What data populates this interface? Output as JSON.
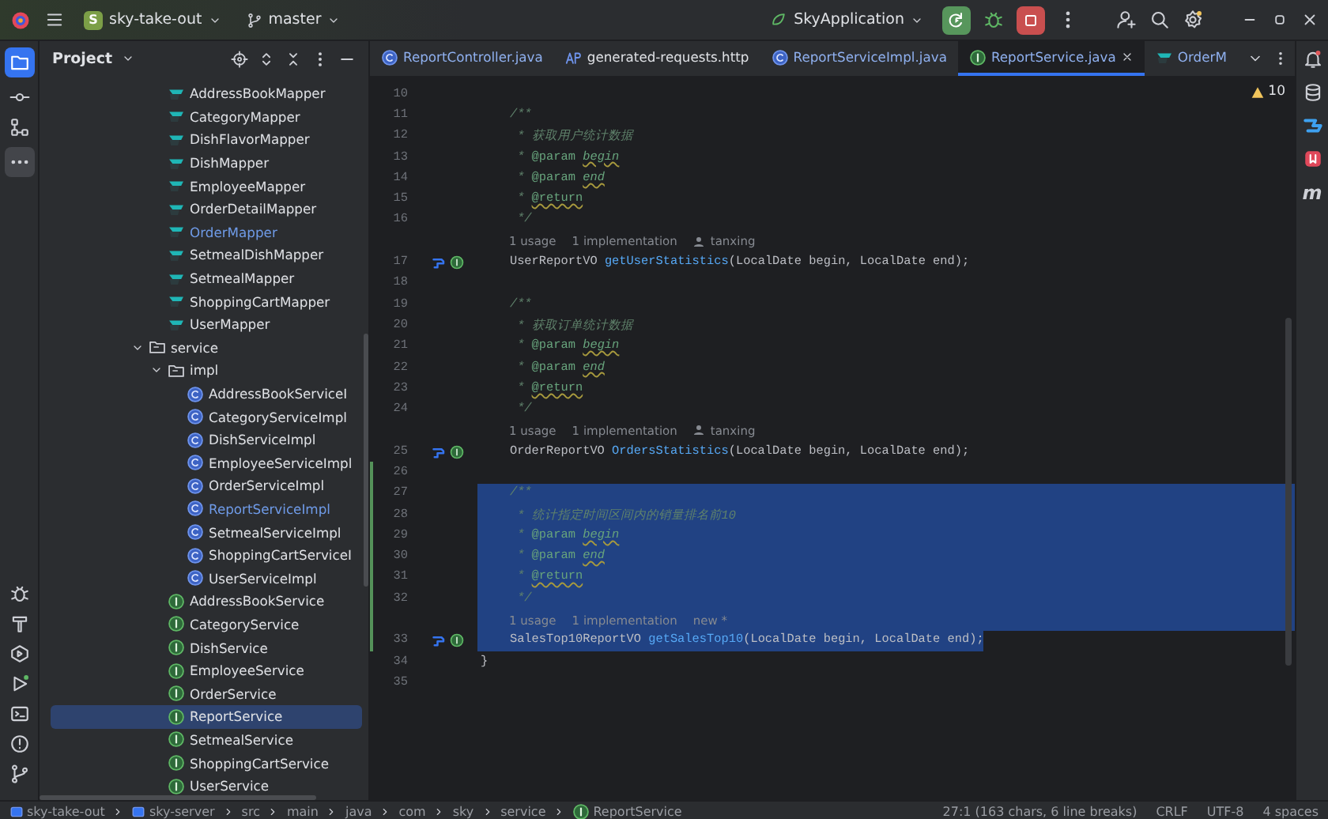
{
  "top_bar": {
    "project_badge": "S",
    "project": "sky-take-out",
    "branch": "master",
    "run_config": "SkyApplication"
  },
  "tool_window": {
    "title": "Project"
  },
  "tree": [
    {
      "children": [
        {
          "label": "AddressBookMapper",
          "kind": "mapper",
          "modified": false,
          "selected": false
        },
        {
          "label": "CategoryMapper",
          "kind": "mapper",
          "modified": false,
          "selected": false
        },
        {
          "label": "DishFlavorMapper",
          "kind": "mapper",
          "modified": false,
          "selected": false
        },
        {
          "label": "DishMapper",
          "kind": "mapper",
          "modified": false,
          "selected": false
        },
        {
          "label": "EmployeeMapper",
          "kind": "mapper",
          "modified": false,
          "selected": false
        },
        {
          "label": "OrderDetailMapper",
          "kind": "mapper",
          "modified": false,
          "selected": false
        },
        {
          "label": "OrderMapper",
          "kind": "mapper",
          "modified": true,
          "selected": false
        },
        {
          "label": "SetmealDishMapper",
          "kind": "mapper",
          "modified": false,
          "selected": false
        },
        {
          "label": "SetmealMapper",
          "kind": "mapper",
          "modified": false,
          "selected": false
        },
        {
          "label": "ShoppingCartMapper",
          "kind": "mapper",
          "modified": false,
          "selected": false
        },
        {
          "label": "UserMapper",
          "kind": "mapper",
          "modified": false,
          "selected": false
        }
      ]
    },
    {
      "label": "service",
      "kind": "folder",
      "expanded": true,
      "modified": false,
      "selected": false,
      "children": [
        {
          "label": "impl",
          "kind": "folder",
          "expanded": true,
          "modified": false,
          "selected": false,
          "children": [
            {
              "label": "AddressBookServiceI",
              "kind": "class",
              "modified": false,
              "selected": false
            },
            {
              "label": "CategoryServiceImpl",
              "kind": "class",
              "modified": false,
              "selected": false
            },
            {
              "label": "DishServiceImpl",
              "kind": "class",
              "modified": false,
              "selected": false
            },
            {
              "label": "EmployeeServiceImpl",
              "kind": "class",
              "modified": false,
              "selected": false
            },
            {
              "label": "OrderServiceImpl",
              "kind": "class",
              "modified": false,
              "selected": false
            },
            {
              "label": "ReportServiceImpl",
              "kind": "class",
              "modified": true,
              "selected": false
            },
            {
              "label": "SetmealServiceImpl",
              "kind": "class",
              "modified": false,
              "selected": false
            },
            {
              "label": "ShoppingCartServiceI",
              "kind": "class",
              "modified": false,
              "selected": false
            },
            {
              "label": "UserServiceImpl",
              "kind": "class",
              "modified": false,
              "selected": false
            }
          ]
        },
        {
          "label": "AddressBookService",
          "kind": "interface",
          "modified": false,
          "selected": false
        },
        {
          "label": "CategoryService",
          "kind": "interface",
          "modified": false,
          "selected": false
        },
        {
          "label": "DishService",
          "kind": "interface",
          "modified": false,
          "selected": false
        },
        {
          "label": "EmployeeService",
          "kind": "interface",
          "modified": false,
          "selected": false
        },
        {
          "label": "OrderService",
          "kind": "interface",
          "modified": false,
          "selected": false
        },
        {
          "label": "ReportService",
          "kind": "interface",
          "modified": false,
          "selected": true
        },
        {
          "label": "SetmealService",
          "kind": "interface",
          "modified": false,
          "selected": false
        },
        {
          "label": "ShoppingCartService",
          "kind": "interface",
          "modified": false,
          "selected": false
        },
        {
          "label": "UserService",
          "kind": "interface",
          "modified": false,
          "selected": false
        }
      ]
    }
  ],
  "tabs": [
    {
      "label": "ReportController.java",
      "kind": "class",
      "selected": false
    },
    {
      "label": "generated-requests.http",
      "kind": "http",
      "selected": false
    },
    {
      "label": "ReportServiceImpl.java",
      "kind": "class",
      "selected": false
    },
    {
      "label": "ReportService.java",
      "kind": "interface",
      "selected": true
    },
    {
      "label": "OrderM",
      "kind": "mapper",
      "selected": false
    }
  ],
  "inspection": {
    "warnings": "10"
  },
  "code_lines": [
    {
      "kind": "code",
      "number": "10",
      "marker": false,
      "changed": false,
      "selected": false
    },
    {
      "kind": "code",
      "number": "11",
      "marker": false,
      "changed": false,
      "selected": false,
      "segments": [
        {
          "text": "    /**",
          "kind": "doc"
        }
      ]
    },
    {
      "kind": "code",
      "number": "12",
      "marker": false,
      "changed": false,
      "selected": false,
      "segments": [
        {
          "text": "     * 获取用户统计数据",
          "kind": "doc"
        }
      ]
    },
    {
      "kind": "code",
      "number": "13",
      "marker": false,
      "changed": false,
      "selected": false,
      "segments": [
        {
          "text": "     * ",
          "kind": "doc"
        },
        {
          "text": "@param ",
          "kind": "tag"
        },
        {
          "text": "begin",
          "kind": "param"
        }
      ]
    },
    {
      "kind": "code",
      "number": "14",
      "marker": false,
      "changed": false,
      "selected": false,
      "segments": [
        {
          "text": "     * ",
          "kind": "doc"
        },
        {
          "text": "@param ",
          "kind": "tag"
        },
        {
          "text": "end",
          "kind": "param"
        }
      ]
    },
    {
      "kind": "code",
      "number": "15",
      "marker": false,
      "changed": false,
      "selected": false,
      "segments": [
        {
          "text": "     * ",
          "kind": "doc"
        },
        {
          "text": "@return",
          "kind": "tagu"
        }
      ]
    },
    {
      "kind": "code",
      "number": "16",
      "marker": false,
      "changed": false,
      "selected": false,
      "segments": [
        {
          "text": "     */",
          "kind": "doc"
        }
      ]
    },
    {
      "kind": "hint",
      "changed": false,
      "selected": false,
      "items": [
        {
          "text": "1 usage",
          "kind": "text"
        },
        {
          "text": "1 implementation",
          "kind": "text"
        },
        {
          "text": "tanxing",
          "kind": "author"
        }
      ]
    },
    {
      "kind": "code",
      "number": "17",
      "marker": true,
      "changed": false,
      "selected": false,
      "segments": [
        {
          "text": "    UserReportVO ",
          "kind": "plain"
        },
        {
          "text": "getUserStatistics",
          "kind": "method"
        },
        {
          "text": "(LocalDate begin, LocalDate end);",
          "kind": "plain"
        }
      ]
    },
    {
      "kind": "code",
      "number": "18",
      "marker": false,
      "changed": false,
      "selected": false
    },
    {
      "kind": "code",
      "number": "19",
      "marker": false,
      "changed": false,
      "selected": false,
      "segments": [
        {
          "text": "    /**",
          "kind": "doc"
        }
      ]
    },
    {
      "kind": "code",
      "number": "20",
      "marker": false,
      "changed": false,
      "selected": false,
      "segments": [
        {
          "text": "     * 获取订单统计数据",
          "kind": "doc"
        }
      ]
    },
    {
      "kind": "code",
      "number": "21",
      "marker": false,
      "changed": false,
      "selected": false,
      "segments": [
        {
          "text": "     * ",
          "kind": "doc"
        },
        {
          "text": "@param ",
          "kind": "tag"
        },
        {
          "text": "begin",
          "kind": "param"
        }
      ]
    },
    {
      "kind": "code",
      "number": "22",
      "marker": false,
      "changed": false,
      "selected": false,
      "segments": [
        {
          "text": "     * ",
          "kind": "doc"
        },
        {
          "text": "@param ",
          "kind": "tag"
        },
        {
          "text": "end",
          "kind": "param"
        }
      ]
    },
    {
      "kind": "code",
      "number": "23",
      "marker": false,
      "changed": false,
      "selected": false,
      "segments": [
        {
          "text": "     * ",
          "kind": "doc"
        },
        {
          "text": "@return",
          "kind": "tagu"
        }
      ]
    },
    {
      "kind": "code",
      "number": "24",
      "marker": false,
      "changed": false,
      "selected": false,
      "segments": [
        {
          "text": "     */",
          "kind": "doc"
        }
      ]
    },
    {
      "kind": "hint",
      "changed": false,
      "selected": false,
      "items": [
        {
          "text": "1 usage",
          "kind": "text"
        },
        {
          "text": "1 implementation",
          "kind": "text"
        },
        {
          "text": "tanxing",
          "kind": "author"
        }
      ]
    },
    {
      "kind": "code",
      "number": "25",
      "marker": true,
      "changed": false,
      "selected": false,
      "segments": [
        {
          "text": "    OrderReportVO ",
          "kind": "plain"
        },
        {
          "text": "OrdersStatistics",
          "kind": "method"
        },
        {
          "text": "(LocalDate begin, LocalDate end);",
          "kind": "plain"
        }
      ]
    },
    {
      "kind": "code",
      "number": "26",
      "marker": false,
      "changed": true,
      "selected": false
    },
    {
      "kind": "code",
      "number": "27",
      "marker": false,
      "changed": true,
      "selected": true,
      "segments": [
        {
          "text": "    /**",
          "kind": "doc"
        }
      ]
    },
    {
      "kind": "code",
      "number": "28",
      "marker": false,
      "changed": true,
      "selected": true,
      "segments": [
        {
          "text": "     * 统计指定时间区间内的销量排名前10",
          "kind": "doc"
        }
      ]
    },
    {
      "kind": "code",
      "number": "29",
      "marker": false,
      "changed": true,
      "selected": true,
      "segments": [
        {
          "text": "     * ",
          "kind": "doc"
        },
        {
          "text": "@param ",
          "kind": "tag"
        },
        {
          "text": "begin",
          "kind": "param"
        }
      ]
    },
    {
      "kind": "code",
      "number": "30",
      "marker": false,
      "changed": true,
      "selected": true,
      "segments": [
        {
          "text": "     * ",
          "kind": "doc"
        },
        {
          "text": "@param ",
          "kind": "tag"
        },
        {
          "text": "end",
          "kind": "param"
        }
      ]
    },
    {
      "kind": "code",
      "number": "31",
      "marker": false,
      "changed": true,
      "selected": true,
      "segments": [
        {
          "text": "     * ",
          "kind": "doc"
        },
        {
          "text": "@return",
          "kind": "tagu"
        }
      ]
    },
    {
      "kind": "code",
      "number": "32",
      "marker": false,
      "changed": true,
      "selected": true,
      "segments": [
        {
          "text": "     */",
          "kind": "doc"
        }
      ]
    },
    {
      "kind": "hint",
      "changed": true,
      "selected": true,
      "items": [
        {
          "text": "1 usage",
          "kind": "text"
        },
        {
          "text": "1 implementation",
          "kind": "text"
        },
        {
          "text": "new *",
          "kind": "text"
        }
      ]
    },
    {
      "kind": "code",
      "number": "33",
      "marker": true,
      "changed": true,
      "selected": true,
      "segments": [
        {
          "text": "    SalesTop10ReportVO ",
          "kind": "plain"
        },
        {
          "text": "getSalesTop10",
          "kind": "method"
        },
        {
          "text": "(LocalDate begin, LocalDate end);",
          "kind": "plain"
        }
      ]
    },
    {
      "kind": "code",
      "number": "34",
      "marker": false,
      "changed": false,
      "selected": false,
      "segments": [
        {
          "text": "}",
          "kind": "plain"
        }
      ]
    },
    {
      "kind": "code",
      "number": "35",
      "marker": false,
      "changed": false,
      "selected": false
    }
  ],
  "right_strip": {
    "maven_label": "m"
  },
  "status_bar": {
    "breadcrumbs": [
      {
        "label": "sky-take-out",
        "kind": "module"
      },
      {
        "label": "sky-server",
        "kind": "module"
      },
      {
        "label": "src",
        "kind": "folder"
      },
      {
        "label": "main",
        "kind": "folder"
      },
      {
        "label": "java",
        "kind": "folder"
      },
      {
        "label": "com",
        "kind": "folder"
      },
      {
        "label": "sky",
        "kind": "folder"
      },
      {
        "label": "service",
        "kind": "folder"
      },
      {
        "label": "ReportService",
        "kind": "interface"
      }
    ],
    "position": "27:1 (163 chars, 6 line breaks)",
    "line_separator": "CRLF",
    "encoding": "UTF-8",
    "indent": "4 spaces"
  }
}
